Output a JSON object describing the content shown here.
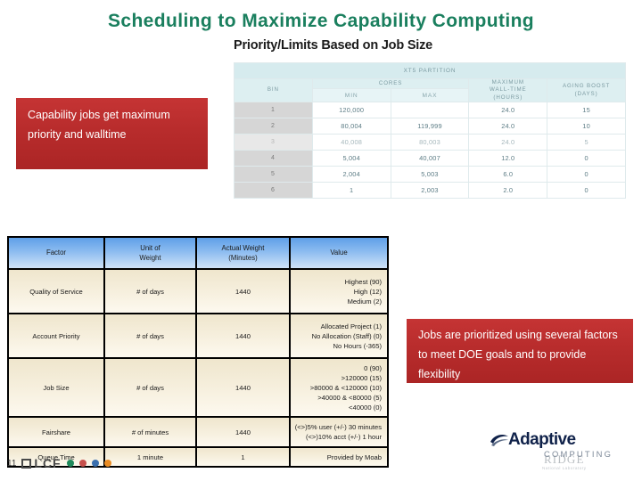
{
  "slide": {
    "title": "Scheduling to Maximize Capability Computing",
    "page_number": "11"
  },
  "top_panel": {
    "title": "Priority/Limits Based on Job Size",
    "partition_header": "XT5 PARTITION",
    "headers": {
      "bin": "BIN",
      "cores": "CORES",
      "min": "MIN",
      "max": "MAX",
      "wall_time": "MAXIMUM WALL-TIME (HOURS)",
      "wall_time_l1": "MAXIMUM",
      "wall_time_l2": "WALL-TIME",
      "wall_time_l3": "(HOURS)",
      "aging_boost_l1": "AGING BOOST",
      "aging_boost_l2": "(DAYS)"
    },
    "rows": [
      {
        "bin": "1",
        "min": "120,000",
        "max": "",
        "walltime": "24.0",
        "aging": "15"
      },
      {
        "bin": "2",
        "min": "80,004",
        "max": "119,999",
        "walltime": "24.0",
        "aging": "10"
      },
      {
        "bin": "3",
        "min": "40,008",
        "max": "80,003",
        "walltime": "24.0",
        "aging": "5"
      },
      {
        "bin": "4",
        "min": "5,004",
        "max": "40,007",
        "walltime": "12.0",
        "aging": "0"
      },
      {
        "bin": "5",
        "min": "2,004",
        "max": "5,003",
        "walltime": "6.0",
        "aging": "0"
      },
      {
        "bin": "6",
        "min": "1",
        "max": "2,003",
        "walltime": "2.0",
        "aging": "0"
      }
    ]
  },
  "callouts": {
    "left": "Capability jobs get maximum priority and walltime",
    "right": "Jobs are prioritized using several factors to meet DOE goals and to provide  flexibility"
  },
  "factors_table": {
    "headers": {
      "factor": "Factor",
      "unit_l1": "Unit of",
      "unit_l2": "Weight",
      "weight_l1": "Actual Weight",
      "weight_l2": "(Minutes)",
      "value": "Value"
    },
    "rows": [
      {
        "factor": "Quality of Service",
        "unit": "# of days",
        "weight": "1440",
        "value": "Highest  (90)\nHigh (12)\nMedium   (2)"
      },
      {
        "factor": "Account Priority",
        "unit": "# of days",
        "weight": "1440",
        "value": "Allocated Project  (1)\nNo Allocation (Staff)   (0)\nNo Hours  (-365)"
      },
      {
        "factor": "Job Size",
        "unit": "# of days",
        "weight": "1440",
        "value": "0  (90)\n>120000  (15)\n>80000  & <120000 (10)\n>40000 &  <80000    (5)\n<40000    (0)"
      },
      {
        "factor": "Fairshare",
        "unit": "# of minutes",
        "weight": "1440",
        "value": "(<>)5% user (+/-)  30 minutes\n(<>)10% acct (+/-)       1 hour"
      },
      {
        "factor": "Queue Time",
        "unit": "1 minute",
        "weight": "1",
        "value": "Provided by Moab"
      }
    ]
  },
  "logos": {
    "olcf_text": "LCF",
    "adaptive_name": "Adaptive",
    "adaptive_sub": "COMPUTING",
    "ornl_ridge": "RIDGE",
    "ornl_sub": "National Laboratory"
  },
  "colors": {
    "title_green": "#1a7f5e",
    "callout_red": "#b82c2c",
    "header_blue": "#8cbcf0",
    "row_cream": "#f6efdd",
    "dot_green": "#1f8a5c",
    "dot_red": "#c7504c",
    "dot_blue": "#3a6fae",
    "dot_orange": "#e98b22"
  }
}
